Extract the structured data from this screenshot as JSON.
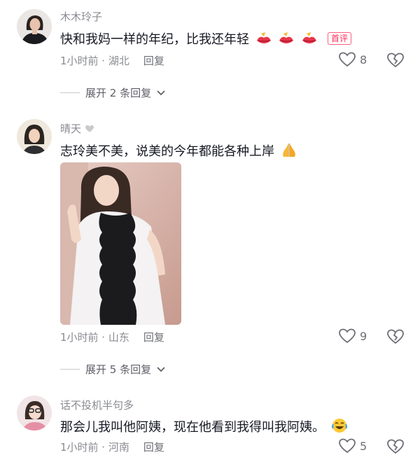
{
  "comments": [
    {
      "username": "木木玲子",
      "text": "快和我妈一样的年纪，比我还年轻",
      "badge": "首评",
      "time_location": "1小时前 · 湖北",
      "reply_label": "回复",
      "likes": "8",
      "expand_label": "展开 2 条回复"
    },
    {
      "username": "晴天",
      "text": "志玲美不美，说美的今年都能各种上岸",
      "time_location": "1小时前 · 山东",
      "reply_label": "回复",
      "likes": "9",
      "expand_label": "展开 5 条回复"
    },
    {
      "username": "话不投机半句多",
      "text": "那会儿我叫他阿姨，现在他看到我得叫我阿姨。",
      "time_location": "1小时前 · 河南",
      "reply_label": "回复",
      "likes": "5"
    }
  ],
  "colors": {
    "text": "#161823",
    "secondary": "#8a8b91",
    "accent": "#fe2c55"
  },
  "icons": [
    "heart-outline-icon",
    "broken-heart-icon",
    "chevron-down-icon",
    "white-heart-icon",
    "lips-emoji-icon",
    "pray-emoji-icon",
    "laugh-cry-emoji-icon"
  ]
}
